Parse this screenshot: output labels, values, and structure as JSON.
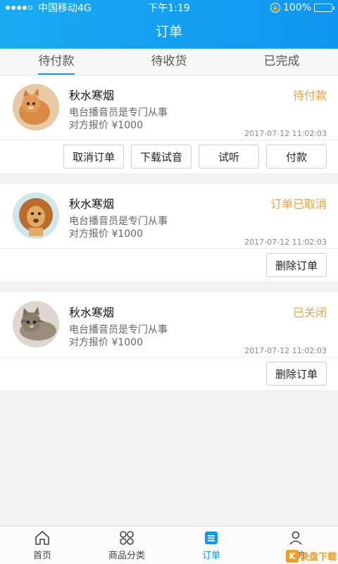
{
  "status_bar": {
    "carrier": "中国移动4G",
    "time": "下午1:19",
    "battery": "100%"
  },
  "header": {
    "title": "订单"
  },
  "tabs": [
    {
      "label": "待付款",
      "active": true
    },
    {
      "label": "待收货",
      "active": false
    },
    {
      "label": "已完成",
      "active": false
    }
  ],
  "orders": [
    {
      "name": "秋水寒烟",
      "desc": "电台播音员是专门从事",
      "price": "对方报价 ¥1000",
      "status": "待付款",
      "time": "2017-07-12  11:02:03",
      "avatar": "cat-avatar",
      "actions": [
        "取消订单",
        "下载试音",
        "试听",
        "付款"
      ]
    },
    {
      "name": "秋水寒烟",
      "desc": "电台播音员是专门从事",
      "price": "对方报价 ¥1000",
      "status": "订单已取消",
      "time": "2017-07-12  11:02:03",
      "avatar": "lion-avatar",
      "actions": [
        "删除订单"
      ]
    },
    {
      "name": "秋水寒烟",
      "desc": "电台播音员是专门从事",
      "price": "对方报价 ¥1000",
      "status": "已关闭",
      "time": "2017-07-12  11:02:03",
      "avatar": "kitten-avatar",
      "actions": [
        "删除订单"
      ]
    }
  ],
  "bottom_nav": [
    {
      "label": "首页",
      "icon": "home-icon"
    },
    {
      "label": "商品分类",
      "icon": "category-icon"
    },
    {
      "label": "订单",
      "icon": "order-icon",
      "active": true
    },
    {
      "label": "我的",
      "icon": "profile-icon"
    }
  ],
  "watermark": {
    "text": "快盘下载"
  },
  "colors": {
    "accent": "#0f96f0",
    "status": "#f0a23c"
  }
}
